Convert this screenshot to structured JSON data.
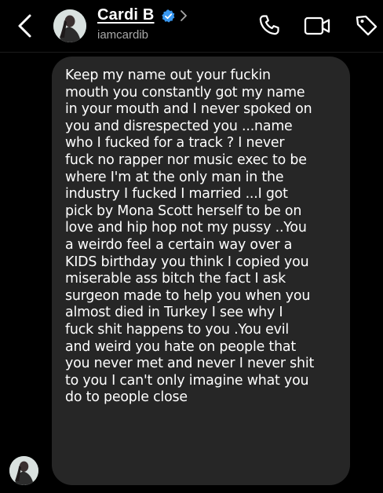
{
  "header": {
    "contact_name": "Cardi B",
    "contact_handle": "iamcardib",
    "icons": [
      "back-chevron-icon",
      "verified-badge-icon",
      "chevron-right-icon",
      "phone-icon",
      "video-camera-icon",
      "tag-icon"
    ]
  },
  "message": {
    "text": "Keep my name out your fuckin\nmouth you constantly got my name\nin your mouth and I never spoked on\nyou and disrespected you ...name\nwho I fucked for a track ? I never\nfuck no rapper nor music exec to be\nwhere I'm at the only man in the\nindustry I fucked I married ...I got\npick by Mona Scott herself to be on\nlove and hip hop not my pussy ..You\na weirdo feel a certain way over a\nKIDS birthday you think I copied you\nmiserable ass bitch the fact I ask\nsurgeon made to help you when you\nalmost died in Turkey I see why I\nfuck shit happens to you .You evil\nand weird you hate on people that\nyou never met and never I never shit\nto you I can't only imagine what you\ndo to people close"
  },
  "colors": {
    "background": "#000000",
    "bubble": "#262626",
    "verified": "#3897f0",
    "handle": "#a8a8a8"
  }
}
